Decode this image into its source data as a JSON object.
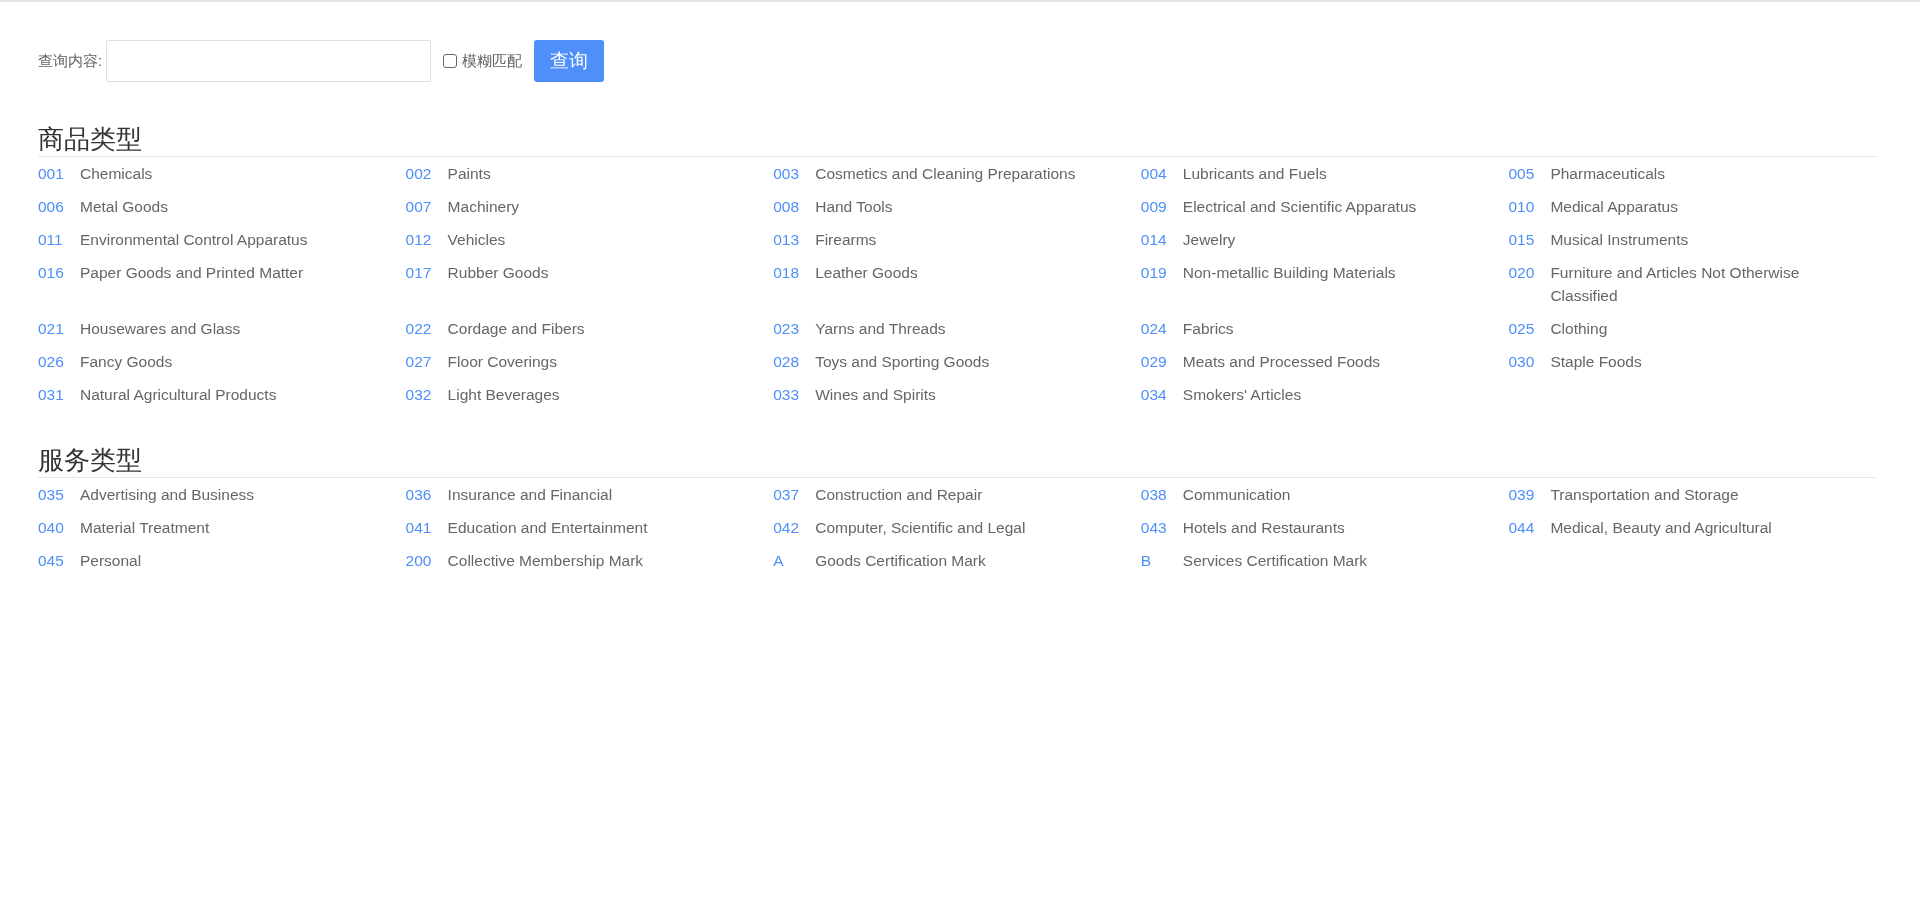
{
  "search": {
    "label": "查询内容:",
    "fuzzy_match": {
      "label": "模糊匹配",
      "checked": false
    },
    "button": "查询"
  },
  "sections": [
    {
      "title": "商品类型",
      "items": [
        {
          "code": "001",
          "name": "Chemicals"
        },
        {
          "code": "002",
          "name": "Paints"
        },
        {
          "code": "003",
          "name": "Cosmetics and Cleaning Preparations"
        },
        {
          "code": "004",
          "name": "Lubricants and Fuels"
        },
        {
          "code": "005",
          "name": "Pharmaceuticals"
        },
        {
          "code": "006",
          "name": "Metal Goods"
        },
        {
          "code": "007",
          "name": "Machinery"
        },
        {
          "code": "008",
          "name": "Hand Tools"
        },
        {
          "code": "009",
          "name": "Electrical and Scientific Apparatus"
        },
        {
          "code": "010",
          "name": "Medical Apparatus"
        },
        {
          "code": "011",
          "name": "Environmental Control Apparatus"
        },
        {
          "code": "012",
          "name": "Vehicles"
        },
        {
          "code": "013",
          "name": "Firearms"
        },
        {
          "code": "014",
          "name": "Jewelry"
        },
        {
          "code": "015",
          "name": "Musical Instruments"
        },
        {
          "code": "016",
          "name": "Paper Goods and Printed Matter"
        },
        {
          "code": "017",
          "name": "Rubber Goods"
        },
        {
          "code": "018",
          "name": "Leather Goods"
        },
        {
          "code": "019",
          "name": "Non-metallic Building Materials"
        },
        {
          "code": "020",
          "name": "Furniture and Articles Not Otherwise Classified"
        },
        {
          "code": "021",
          "name": "Housewares and Glass"
        },
        {
          "code": "022",
          "name": "Cordage and Fibers"
        },
        {
          "code": "023",
          "name": "Yarns and Threads"
        },
        {
          "code": "024",
          "name": "Fabrics"
        },
        {
          "code": "025",
          "name": "Clothing"
        },
        {
          "code": "026",
          "name": "Fancy Goods"
        },
        {
          "code": "027",
          "name": "Floor Coverings"
        },
        {
          "code": "028",
          "name": "Toys and Sporting Goods"
        },
        {
          "code": "029",
          "name": "Meats and Processed Foods"
        },
        {
          "code": "030",
          "name": "Staple Foods"
        },
        {
          "code": "031",
          "name": "Natural Agricultural Products"
        },
        {
          "code": "032",
          "name": "Light Beverages"
        },
        {
          "code": "033",
          "name": "Wines and Spirits"
        },
        {
          "code": "034",
          "name": "Smokers' Articles"
        }
      ]
    },
    {
      "title": "服务类型",
      "items": [
        {
          "code": "035",
          "name": "Advertising and Business"
        },
        {
          "code": "036",
          "name": "Insurance and Financial"
        },
        {
          "code": "037",
          "name": "Construction and Repair"
        },
        {
          "code": "038",
          "name": "Communication"
        },
        {
          "code": "039",
          "name": "Transportation and Storage"
        },
        {
          "code": "040",
          "name": "Material Treatment"
        },
        {
          "code": "041",
          "name": "Education and Entertainment"
        },
        {
          "code": "042",
          "name": "Computer, Scientific and Legal"
        },
        {
          "code": "043",
          "name": "Hotels and Restaurants"
        },
        {
          "code": "044",
          "name": "Medical, Beauty and Agricultural"
        },
        {
          "code": "045",
          "name": "Personal"
        },
        {
          "code": "200",
          "name": "Collective Membership Mark"
        },
        {
          "code": "A",
          "name": "Goods Certification Mark"
        },
        {
          "code": "B",
          "name": "Services Certification Mark"
        }
      ]
    }
  ]
}
